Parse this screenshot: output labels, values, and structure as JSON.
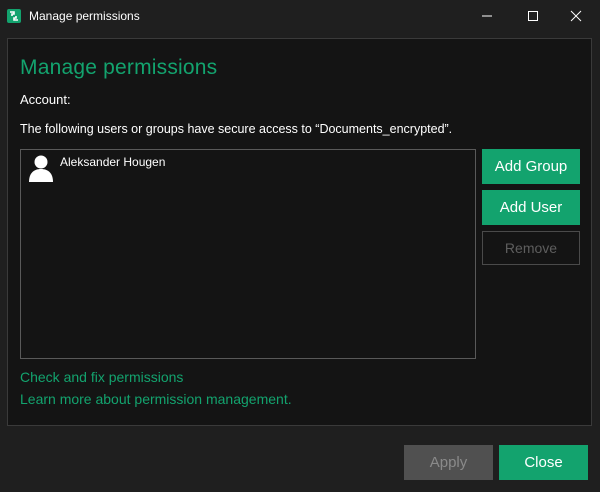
{
  "window": {
    "title": "Manage permissions",
    "icon": "app-logo-icon",
    "controls": [
      "minimize-icon",
      "maximize-icon",
      "close-icon"
    ]
  },
  "dialog": {
    "heading": "Manage permissions",
    "account_label": "Account:",
    "account_value": "",
    "description": "The following users or groups have secure access to “Documents_encrypted”."
  },
  "users": [
    {
      "name": "Aleksander Hougen",
      "icon": "user-icon"
    }
  ],
  "actions": {
    "add_group": "Add Group",
    "add_user": "Add User",
    "remove": "Remove"
  },
  "links": {
    "check_fix": "Check and fix permissions",
    "learn_more": "Learn more about permission management."
  },
  "footer": {
    "apply": "Apply",
    "close": "Close"
  },
  "colors": {
    "accent": "#13a36e",
    "background": "#1f1f1f",
    "panel": "#141414",
    "disabled_button": "#505050"
  }
}
